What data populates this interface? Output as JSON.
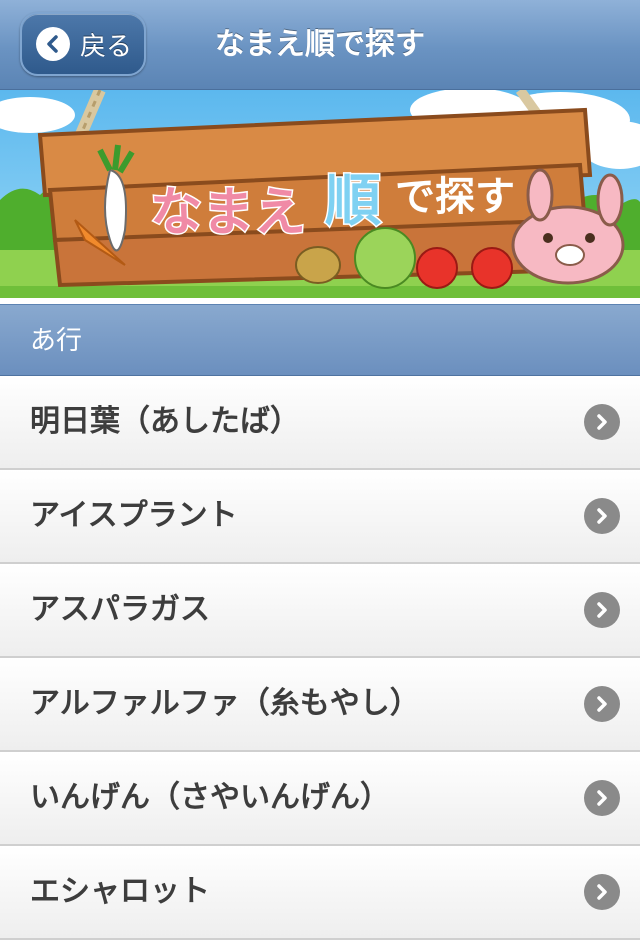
{
  "navbar": {
    "back_label": "戻る",
    "title": "なまえ順で探す"
  },
  "banner": {
    "sign_text": "なまえ順で探す"
  },
  "section": {
    "header": "あ行"
  },
  "list": {
    "items": [
      {
        "label": "明日葉（あしたば）"
      },
      {
        "label": "アイスプラント"
      },
      {
        "label": "アスパラガス"
      },
      {
        "label": "アルファルファ（糸もやし）"
      },
      {
        "label": "いんげん（さやいんげん）"
      },
      {
        "label": "エシャロット"
      }
    ]
  }
}
